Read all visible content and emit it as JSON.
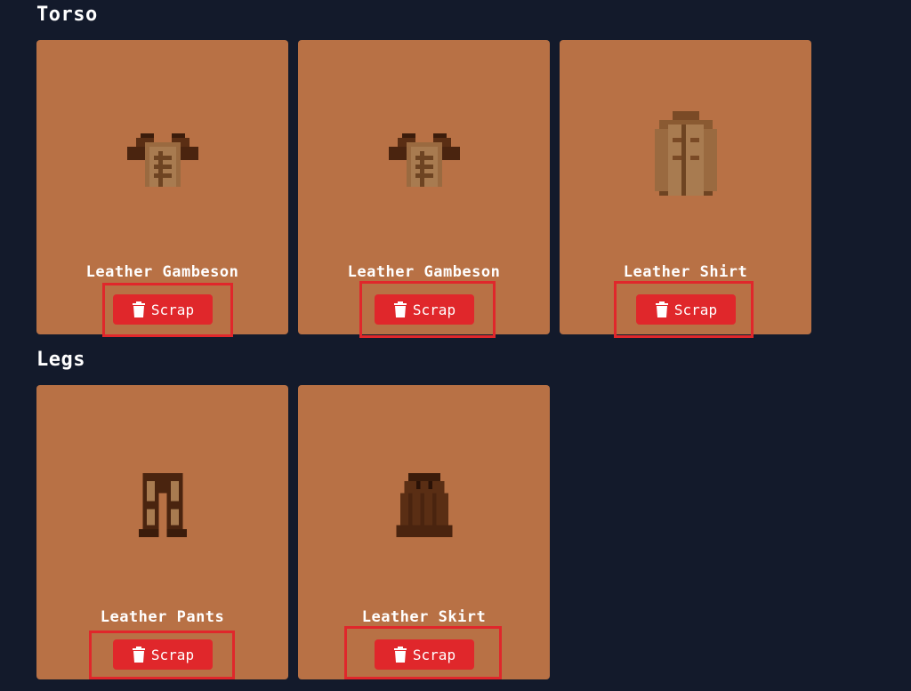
{
  "sections": {
    "torso": {
      "title": "Torso",
      "items": [
        {
          "name": "Leather Gambeson",
          "button_label": "Scrap",
          "icon": "leather-gambeson-icon"
        },
        {
          "name": "Leather Gambeson",
          "button_label": "Scrap",
          "icon": "leather-gambeson-icon"
        },
        {
          "name": "Leather Shirt",
          "button_label": "Scrap",
          "icon": "leather-shirt-icon"
        }
      ]
    },
    "legs": {
      "title": "Legs",
      "items": [
        {
          "name": "Leather Pants",
          "button_label": "Scrap",
          "icon": "leather-pants-icon"
        },
        {
          "name": "Leather Skirt",
          "button_label": "Scrap",
          "icon": "leather-skirt-icon"
        }
      ]
    }
  },
  "colors": {
    "background": "#131a2b",
    "card": "#b87145",
    "button": "#e0272b",
    "highlight": "#e0272b"
  }
}
